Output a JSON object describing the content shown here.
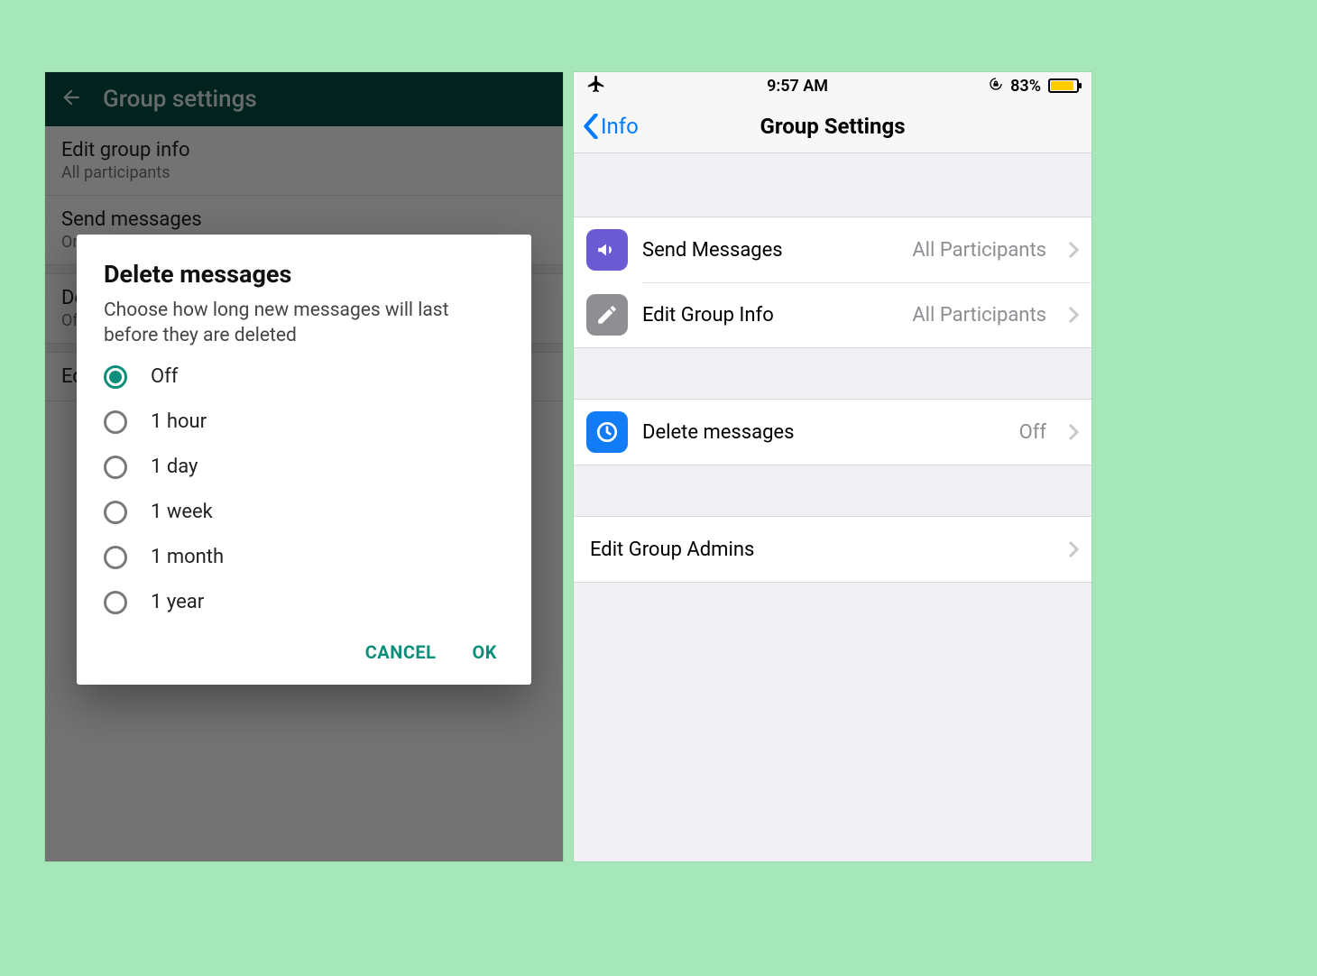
{
  "android": {
    "header_title": "Group settings",
    "rows": [
      {
        "title": "Edit group info",
        "subtitle": "All participants"
      },
      {
        "title": "Send messages",
        "subtitle": "Only admins"
      },
      {
        "title": "Delete messages",
        "subtitle": "Off"
      },
      {
        "title": "Edit group admins",
        "subtitle": ""
      }
    ],
    "dialog": {
      "title": "Delete messages",
      "subtitle": "Choose how long new messages will last before they are deleted",
      "options": [
        "Off",
        "1 hour",
        "1 day",
        "1 week",
        "1 month",
        "1 year"
      ],
      "selected_index": 0,
      "cancel": "CANCEL",
      "ok": "OK"
    }
  },
  "ios": {
    "status": {
      "time": "9:57 AM",
      "battery_pct": "83%"
    },
    "nav": {
      "back": "Info",
      "title": "Group Settings"
    },
    "cells": {
      "send": {
        "label": "Send Messages",
        "value": "All Participants"
      },
      "edit": {
        "label": "Edit Group Info",
        "value": "All Participants"
      },
      "delete": {
        "label": "Delete messages",
        "value": "Off"
      },
      "admins": {
        "label": "Edit Group Admins",
        "value": ""
      }
    }
  }
}
